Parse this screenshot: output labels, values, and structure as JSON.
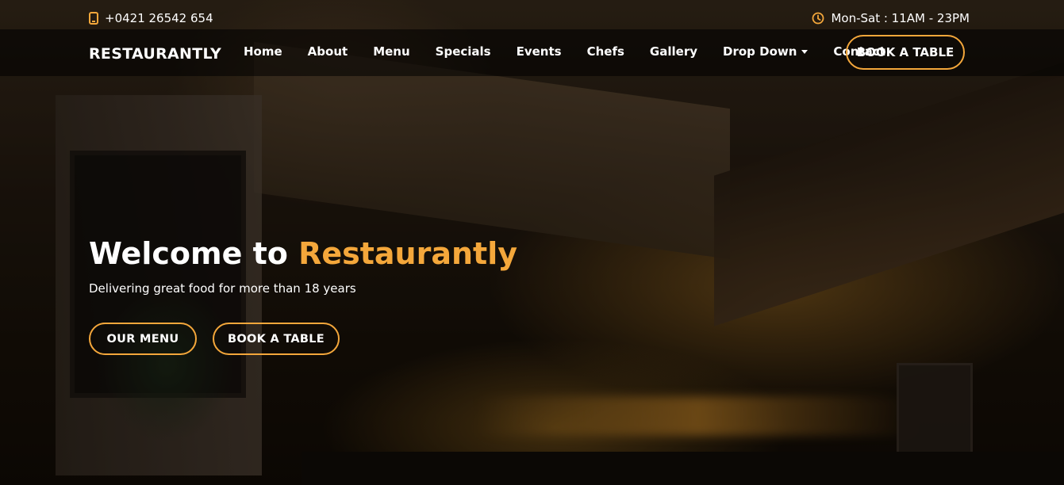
{
  "topbar": {
    "phone": "+0421 26542 654",
    "phone_icon": "phone-icon",
    "hours": "Mon-Sat : 11AM - 23PM",
    "hours_icon": "clock-icon"
  },
  "header": {
    "logo": "RESTAURANTLY",
    "nav": [
      {
        "label": "Home"
      },
      {
        "label": "About"
      },
      {
        "label": "Menu"
      },
      {
        "label": "Specials"
      },
      {
        "label": "Events"
      },
      {
        "label": "Chefs"
      },
      {
        "label": "Gallery"
      },
      {
        "label": "Drop Down"
      },
      {
        "label": "Contact"
      }
    ],
    "book_button": "BOOK A TABLE"
  },
  "hero": {
    "title_prefix": "Welcome to ",
    "title_accent": "Restaurantly",
    "subtitle": "Delivering great food for more than 18 years",
    "menu_button": "OUR MENU",
    "book_button": "BOOK A TABLE"
  },
  "colors": {
    "accent": "#f4a73b",
    "navbar_bg": "rgba(0,0,0,0.55)"
  }
}
